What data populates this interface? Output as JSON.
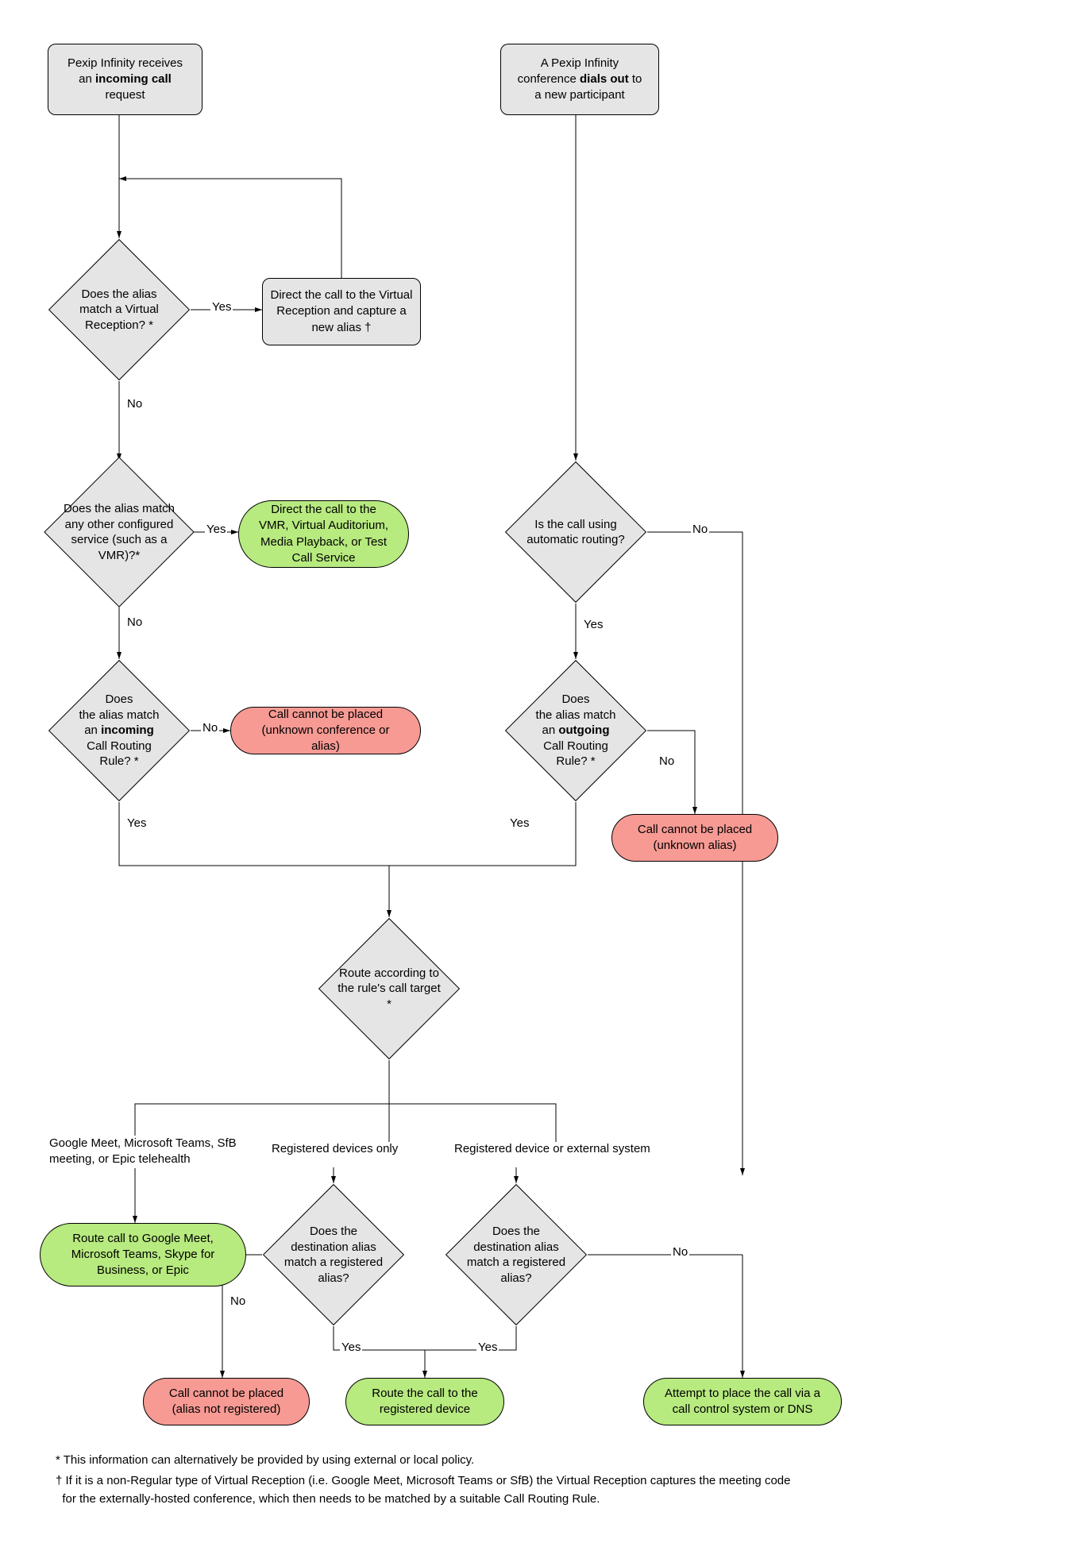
{
  "nodes": {
    "start_in_l1": "Pexip Infinity receives",
    "start_in_l2": "an ",
    "start_in_bold": "incoming call",
    "start_in_l3": "request",
    "start_out_l1": "A Pexip Infinity",
    "start_out_l2a": "conference ",
    "start_out_bold": "dials out",
    "start_out_l2b": " to",
    "start_out_l3": "a new participant",
    "d_vr": "Does the alias match a Virtual Reception? *",
    "vr_capture": "Direct the call to the Virtual Reception and capture a new alias †",
    "d_svc": "Does the alias match any other configured service (such as a VMR)?*",
    "svc_green": "Direct the call to the VMR, Virtual Auditorium, Media Playback, or Test Call Service",
    "d_in_rule_l1": "Does",
    "d_in_rule_l2": "the alias match",
    "d_in_rule_l3a": "an ",
    "d_in_rule_bold": "incoming",
    "d_in_rule_l4": "Call Routing",
    "d_in_rule_l5": "Rule? *",
    "red_unknown_conf": "Call cannot be placed (unknown conference or alias)",
    "d_auto": "Is the call using automatic routing?",
    "d_out_rule_l1": "Does",
    "d_out_rule_l2": "the alias match",
    "d_out_rule_l3a": "an ",
    "d_out_rule_bold": "outgoing",
    "d_out_rule_l4": "Call Routing",
    "d_out_rule_l5": "Rule? *",
    "red_unknown_alias": "Call cannot be placed (unknown alias)",
    "d_route": "Route according to the rule's call target *",
    "branch1": "Google Meet, Microsoft Teams, SfB meeting, or Epic telehealth",
    "branch2": "Registered devices only",
    "branch3": "Registered device or external system",
    "green_gm": "Route call to Google Meet, Microsoft Teams, Skype for Business, or Epic",
    "d_reg1": "Does the destination alias match a registered alias?",
    "d_reg2": "Does the destination alias match a registered alias?",
    "red_not_reg": "Call cannot be placed (alias not registered)",
    "green_reg": "Route the call to the registered device",
    "green_dns": "Attempt to place the call via a call control system or DNS"
  },
  "labels": {
    "yes": "Yes",
    "no": "No"
  },
  "footnotes": {
    "f1": "* This information can alternatively be provided by using external or local policy.",
    "f2a": "† If it is a non-Regular type of Virtual Reception (i.e. Google Meet, Microsoft Teams or SfB) the Virtual Reception captures the meeting code",
    "f2b": "for the externally-hosted conference, which then needs to be matched by a suitable Call Routing Rule."
  }
}
